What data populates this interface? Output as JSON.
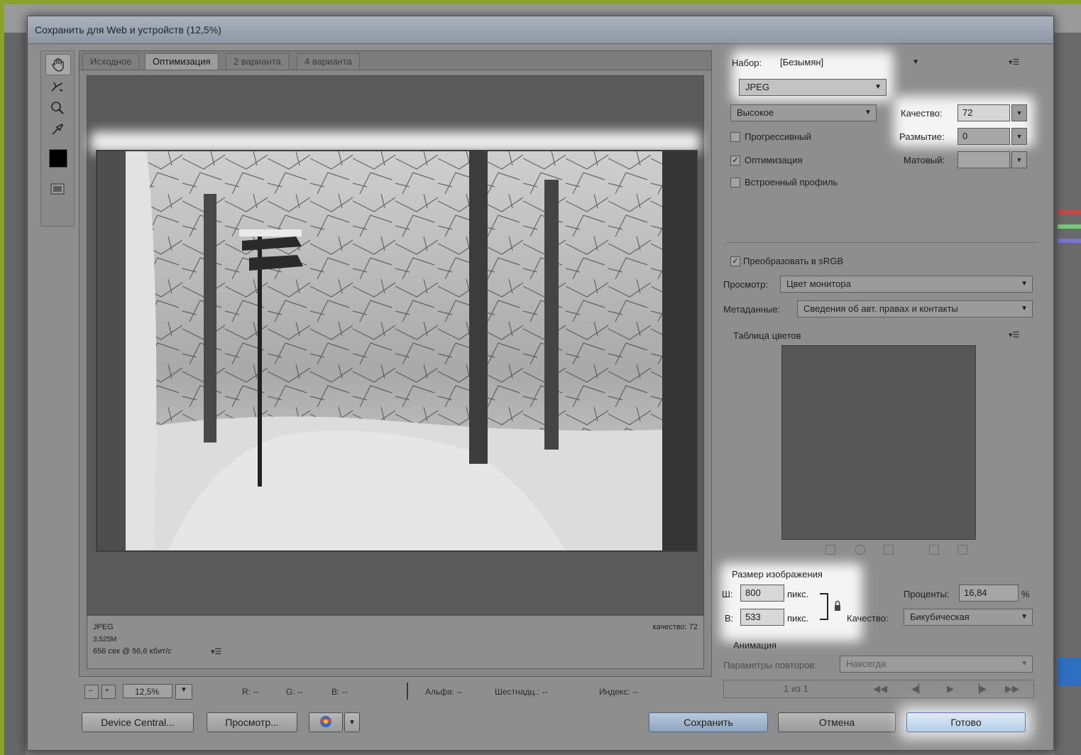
{
  "dialog": {
    "title": "Сохранить для Web и устройств (12,5%)"
  },
  "tabs": [
    {
      "label": "Исходное"
    },
    {
      "label": "Оптимизация"
    },
    {
      "label": "2 варианта"
    },
    {
      "label": "4 варианта"
    }
  ],
  "preview_info": {
    "format": "JPEG",
    "size": "3,525M",
    "time": "656 сек @ 56,6 кбит/с",
    "quality": "качество: 72"
  },
  "status": {
    "zoom": "12,5%",
    "r": "R: --",
    "g": "G: --",
    "b": "B: --",
    "alpha": "Альфа: --",
    "hex": "Шестнадц.: --",
    "index": "Индекс: --"
  },
  "buttons": {
    "device_central": "Device Central...",
    "preview": "Просмотр...",
    "save": "Сохранить",
    "cancel": "Отмена",
    "done": "Готово"
  },
  "settings": {
    "preset_label": "Набор:",
    "preset_value": "[Безымян]",
    "format_value": "JPEG",
    "quality_level_value": "Высокое",
    "quality_label": "Качество:",
    "quality_value": "72",
    "progressive_label": "Прогрессивный",
    "progressive_checked": false,
    "optimized_label": "Оптимизация",
    "optimized_checked": true,
    "embed_profile_label": "Встроенный профиль",
    "embed_profile_checked": false,
    "blur_label": "Размытие:",
    "blur_value": "0",
    "matte_label": "Матовый:",
    "matte_value": ""
  },
  "color": {
    "convert_srgb_label": "Преобразовать в sRGB",
    "convert_srgb_checked": true,
    "preview_label": "Просмотр:",
    "preview_value": "Цвет монитора",
    "metadata_label": "Метаданные:",
    "metadata_value": "Сведения об авт. правах и контакты",
    "color_table_label": "Таблица цветов"
  },
  "image_size": {
    "section_label": "Размер изображения",
    "w_label": "Ш:",
    "w_value": "800",
    "h_label": "В:",
    "h_value": "533",
    "unit": "пикс.",
    "percent_label": "Проценты:",
    "percent_value": "16,84",
    "percent_unit": "%",
    "quality_label": "Качество:",
    "quality_value": "Бикубическая"
  },
  "animation": {
    "section_label": "Анимация",
    "loop_label": "Параметры повторов:",
    "loop_value": "Навсегда",
    "frame_counter": "1 из 1"
  },
  "icons": {
    "hand": "hand-icon",
    "slice": "slice-select-icon",
    "zoom": "zoom-icon",
    "eyedropper": "eyedropper-icon",
    "panel_menu": "panel-menu-icon"
  }
}
